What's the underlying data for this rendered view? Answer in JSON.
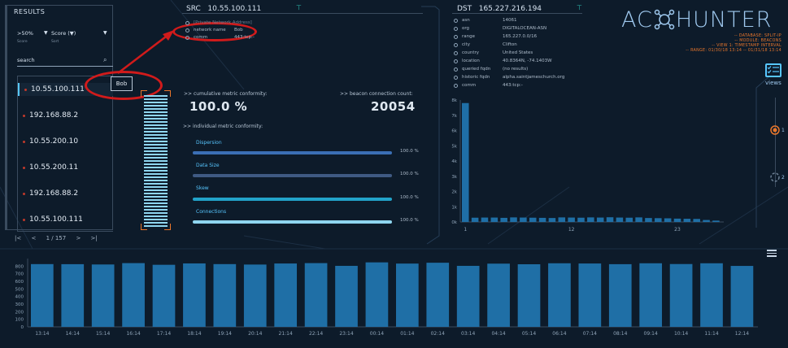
{
  "results": {
    "title": "RESULTS",
    "filter1": {
      "value": ">50%",
      "caption": "Score"
    },
    "filter2": {
      "value": "Score (▼)",
      "caption": "Sort"
    },
    "search_label": "search",
    "items": [
      {
        "label": "10.55.100.111",
        "selected": true
      },
      {
        "label": "192.168.88.2"
      },
      {
        "label": "10.55.200.10"
      },
      {
        "label": "10.55.200.11"
      },
      {
        "label": "192.168.88.2"
      },
      {
        "label": "10.55.100.111"
      }
    ],
    "pager": {
      "first": "|<",
      "prev": "<",
      "page": "1 / 157",
      "next": ">",
      "last": ">|"
    }
  },
  "annotation": {
    "tag": "Bob"
  },
  "src": {
    "label": "SRC",
    "ip": "10.55.100.111",
    "rows": [
      {
        "key": "[Private Network Address]",
        "value": "",
        "muted": true
      },
      {
        "key": "network name",
        "value": "Bob"
      },
      {
        "key": "comm",
        "value": "443:tcp:-"
      }
    ]
  },
  "dst": {
    "label": "DST",
    "ip": "165.227.216.194",
    "rows": [
      {
        "key": "asn",
        "value": "14061"
      },
      {
        "key": "org",
        "value": "DIGITALOCEAN-ASN"
      },
      {
        "key": "range",
        "value": "165.227.0.0/16"
      },
      {
        "key": "city",
        "value": "Clifton"
      },
      {
        "key": "country",
        "value": "United States"
      },
      {
        "key": "location",
        "value": "40.8364N, -74.1403W"
      },
      {
        "key": "queried fqdn",
        "value": "(no results)"
      },
      {
        "key": "historic fqdn",
        "value": "alpha.saintjameschurch.org"
      },
      {
        "key": "comm",
        "value": "443:tcp:-"
      }
    ]
  },
  "metrics": {
    "cumulative_label": ">> cumulative metric conformity:",
    "cumulative_value": "100.0 %",
    "beacon_label": ">> beacon connection count:",
    "beacon_value": "20054",
    "individual_label": ">> individual metric conformity:",
    "items": [
      {
        "name": "Dispersion",
        "value": "100.0 %",
        "fraction": 1.0,
        "color": "#3b6fb5"
      },
      {
        "name": "Data Size",
        "value": "100.0 %",
        "fraction": 1.0,
        "color": "#3f5a83"
      },
      {
        "name": "Skew",
        "value": "100.0 %",
        "fraction": 1.0,
        "color": "#22a3c9"
      },
      {
        "name": "Connections",
        "value": "100.0 %",
        "fraction": 1.0,
        "color": "#8fd6f0"
      }
    ]
  },
  "logo": {
    "left": "AC",
    "right": "HUNTER"
  },
  "context": [
    "-- DATABASE: SPLIT-IP",
    "-- MODULE: BEACONS",
    "-- VIEW 1: TIMESTAMP INTERVAL",
    "-- RANGE: 01/30/18 13:14 -- 01/31/18 13:14"
  ],
  "views": {
    "label": "views",
    "options": [
      "1",
      "2"
    ]
  },
  "colors": {
    "accent": "#57c6ff",
    "bar": "#1f6fa6",
    "orange": "#e8762b",
    "annotation": "#d11b1b"
  },
  "chart_data": [
    {
      "type": "bar",
      "name": "interval histogram",
      "x": [
        1,
        2,
        3,
        4,
        5,
        6,
        7,
        8,
        9,
        10,
        11,
        12,
        13,
        14,
        15,
        16,
        17,
        18,
        19,
        20,
        21,
        22,
        23,
        24,
        25,
        26,
        27
      ],
      "x_tick_labels": [
        "1",
        "12",
        "23"
      ],
      "values": [
        7800,
        280,
        290,
        290,
        270,
        300,
        290,
        280,
        270,
        260,
        300,
        290,
        280,
        300,
        290,
        310,
        290,
        280,
        300,
        260,
        250,
        240,
        220,
        210,
        200,
        130,
        90
      ],
      "ylim": [
        0,
        8000
      ],
      "y_tick_labels": [
        "0k",
        "1k",
        "2k",
        "3k",
        "4k",
        "5k",
        "6k",
        "7k",
        "8k"
      ]
    },
    {
      "type": "bar",
      "name": "hourly connections",
      "categories": [
        "13:14",
        "14:14",
        "15:14",
        "16:14",
        "17:14",
        "18:14",
        "19:14",
        "20:14",
        "21:14",
        "22:14",
        "23:14",
        "00:14",
        "01:14",
        "02:14",
        "03:14",
        "04:14",
        "05:14",
        "06:14",
        "07:14",
        "08:14",
        "09:14",
        "10:14",
        "11:14",
        "12:14"
      ],
      "values": [
        827,
        826,
        822,
        840,
        818,
        836,
        827,
        821,
        835,
        840,
        804,
        850,
        834,
        845,
        804,
        833,
        825,
        838,
        835,
        826,
        838,
        828,
        838,
        803
      ],
      "ylim": [
        0,
        900
      ],
      "y_tick_labels": [
        "0",
        "100",
        "200",
        "300",
        "400",
        "500",
        "600",
        "700",
        "800"
      ]
    }
  ]
}
